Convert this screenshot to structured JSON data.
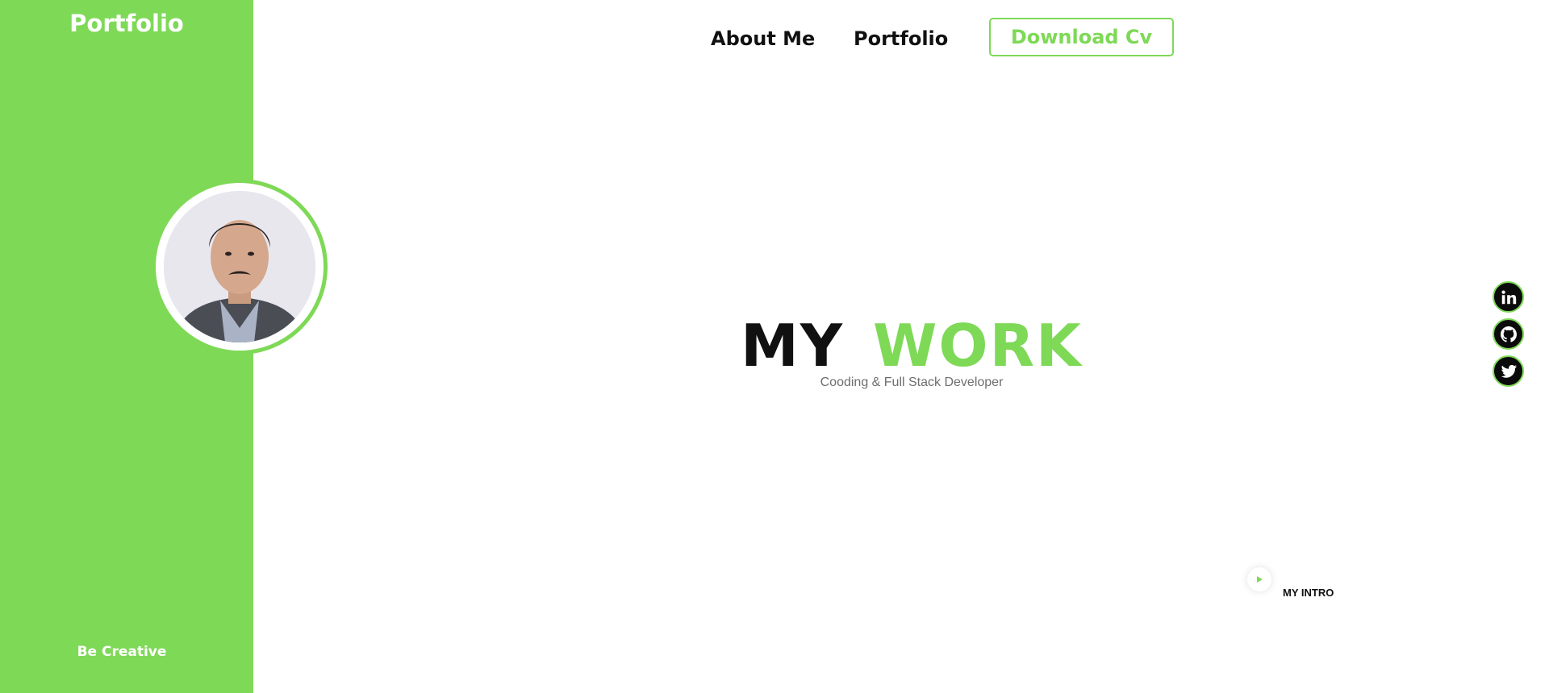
{
  "sidebar": {
    "brand": "Portfolio",
    "tagline": "Be Creative"
  },
  "nav": {
    "about_label": "About Me",
    "portfolio_label": "Portfolio",
    "cv_label": "Download Cv"
  },
  "hero": {
    "title_word1": "MY",
    "title_word2": "WORK",
    "subtitle": "Cooding & Full Stack Developer"
  },
  "social": {
    "icons": [
      "linkedin-icon",
      "github-icon",
      "twitter-icon"
    ]
  },
  "intro": {
    "label": "MY INTRO",
    "icon": "play-icon"
  },
  "colors": {
    "accent": "#7ed957",
    "text": "#111111",
    "muted": "#6e6e6e",
    "background": "#ffffff"
  }
}
